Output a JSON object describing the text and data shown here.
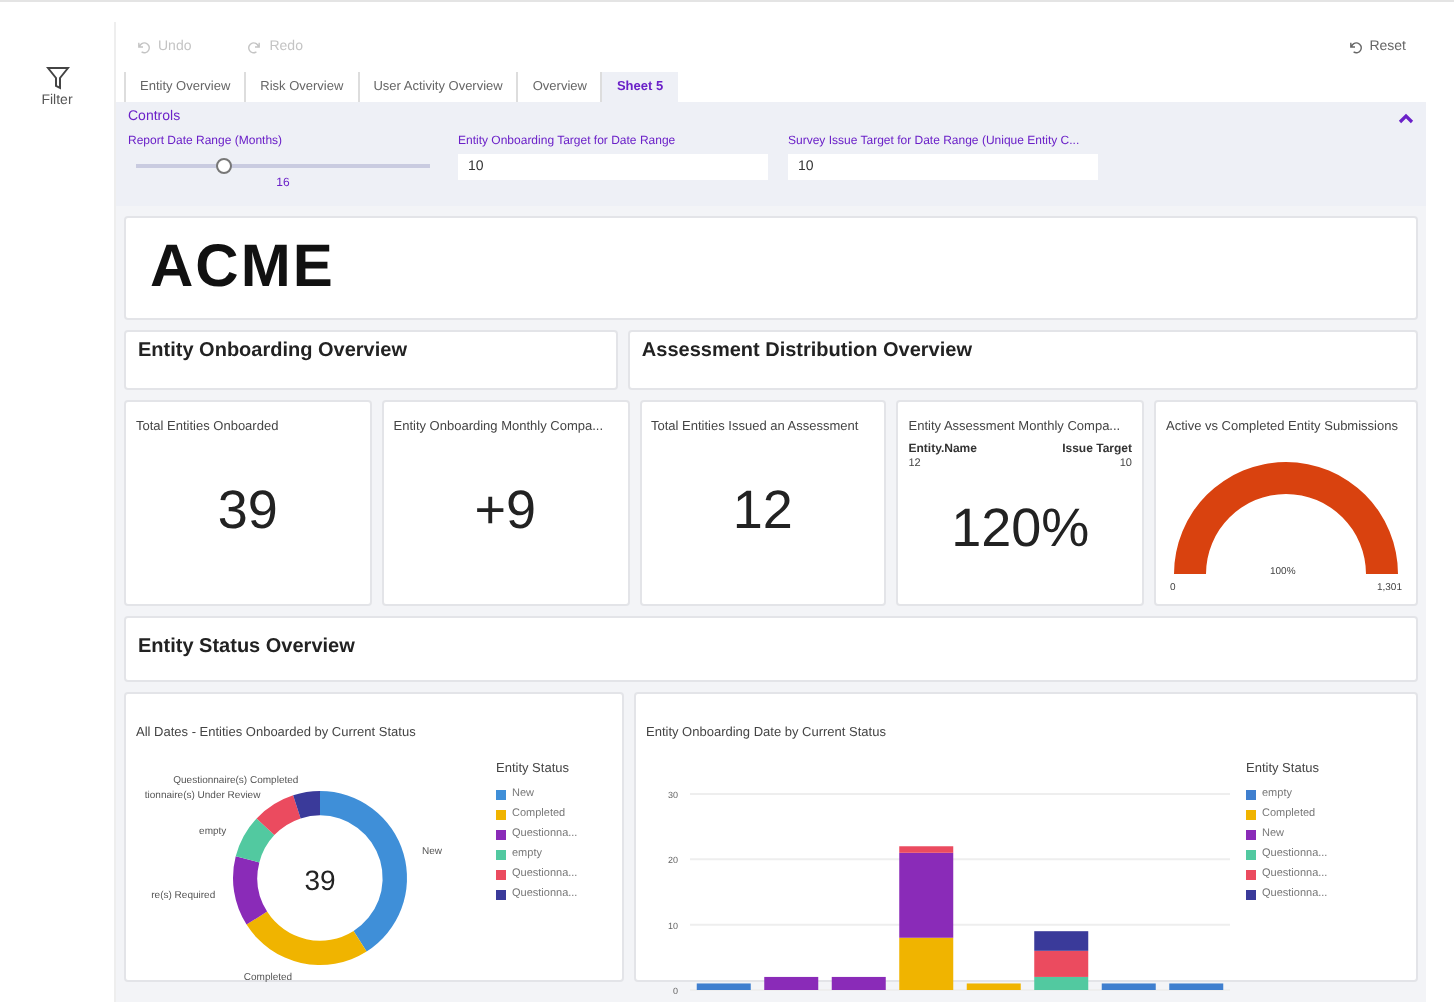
{
  "sidebar": {
    "filter_label": "Filter"
  },
  "toolbar": {
    "undo": {
      "label": "Undo",
      "disabled": true
    },
    "redo": {
      "label": "Redo",
      "disabled": true
    },
    "reset": {
      "label": "Reset",
      "disabled": false
    }
  },
  "tabs": [
    {
      "label": "Entity Overview",
      "selected": false
    },
    {
      "label": "Risk Overview",
      "selected": false
    },
    {
      "label": "User Activity Overview",
      "selected": false
    },
    {
      "label": "Overview",
      "selected": false
    },
    {
      "label": "Sheet 5",
      "selected": true
    }
  ],
  "controls": {
    "title": "Controls",
    "expanded": true,
    "slider": {
      "label": "Report Date Range (Months)",
      "level": 0.3,
      "value": "16"
    },
    "fields": [
      {
        "label": "Entity Onboarding Target for Date Range",
        "value": "10"
      },
      {
        "label": "Survey Issue Target for Date Range (Unique Entity C...",
        "value": "10"
      }
    ]
  },
  "logo": {
    "text": "ACME"
  },
  "section_headers": [
    "Entity Onboarding Overview",
    "Assessment Distribution Overview"
  ],
  "kpis": [
    {
      "kind": "number",
      "title": "Total Entities Onboarded",
      "value": "39"
    },
    {
      "kind": "number",
      "title": "Entity Onboarding Monthly Compa...",
      "value": "+9"
    },
    {
      "kind": "number",
      "title": "Total Entities Issued an Assessment",
      "value": "12"
    },
    {
      "kind": "compare",
      "title": "Entity Assessment Monthly Compa...",
      "left_label": "Entity.Name",
      "right_label": "Issue Target",
      "left_value": "12",
      "right_value": "10",
      "value": "120%"
    },
    {
      "kind": "gauge",
      "title": "Active vs Completed Entity Submissions",
      "min": "0",
      "center": "100%",
      "max": "1,301"
    }
  ],
  "status_header": "Entity Status Overview",
  "donut_card": {
    "title": "All Dates - Entities Onboarded by Current Status",
    "center": "39",
    "legend_title": "Entity Status",
    "legend": [
      {
        "label": "New",
        "color": "#3f8fd8"
      },
      {
        "label": "Completed",
        "color": "#f0b400"
      },
      {
        "label": "Questionna...",
        "color": "#8a2bb8"
      },
      {
        "label": "empty",
        "color": "#52c9a0"
      },
      {
        "label": "Questionna...",
        "color": "#eb4b5f"
      },
      {
        "label": "Questionna...",
        "color": "#3a3a9a"
      }
    ],
    "chart_data": {
      "type": "donut",
      "categories": [
        "New",
        "Completed",
        "re(s) Required",
        "empty",
        "tionnaire(s) Under Review",
        "Questionnaire(s) Completed"
      ],
      "values": [
        41,
        25,
        13,
        8,
        8,
        5
      ]
    }
  },
  "bar_card": {
    "title": "Entity Onboarding Date by Current Status",
    "legend_title": "Entity Status",
    "chart_data": {
      "type": "bar",
      "stacked": true,
      "ylim": [
        0,
        30
      ],
      "yticks": [
        0,
        10,
        20,
        30
      ],
      "series": [
        {
          "name": "empty",
          "color": "#3f7fcf",
          "values": [
            1,
            0,
            0,
            0,
            0,
            0,
            1,
            1
          ]
        },
        {
          "name": "Completed",
          "color": "#f0b400",
          "values": [
            0,
            0,
            0,
            8,
            1,
            0,
            0,
            0
          ]
        },
        {
          "name": "New",
          "color": "#8a2bb8",
          "values": [
            0,
            2,
            2,
            13,
            0,
            0,
            0,
            0
          ]
        },
        {
          "name": "Questionna...",
          "color": "#52c9a0",
          "values": [
            0,
            0,
            0,
            0,
            0,
            2,
            0,
            0
          ]
        },
        {
          "name": "Questionna...",
          "color": "#eb4b5f",
          "values": [
            0,
            0,
            0,
            1,
            0,
            4,
            0,
            0
          ]
        },
        {
          "name": "Questionna...",
          "color": "#3a3a9a",
          "values": [
            0,
            0,
            0,
            0,
            0,
            3,
            0,
            0
          ]
        }
      ]
    }
  }
}
